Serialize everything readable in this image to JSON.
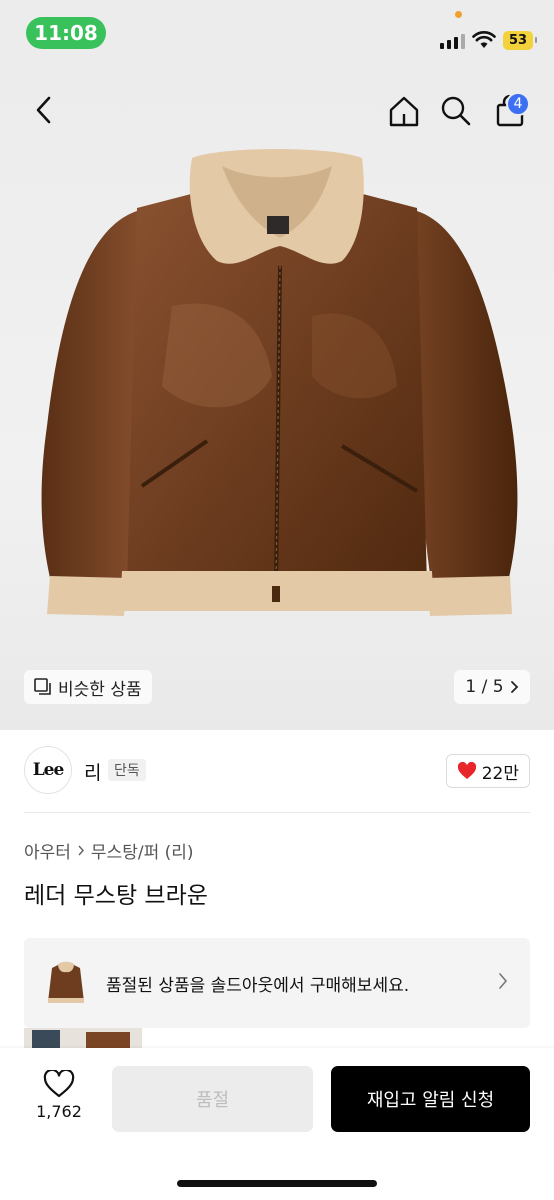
{
  "status_bar": {
    "time": "11:08",
    "battery": "53",
    "time_color": "#39c25c"
  },
  "header": {
    "cart_count": "4",
    "badge_color": "#3d6ff3"
  },
  "hero": {
    "similar_label": "비슷한 상품",
    "pager": "1 / 5"
  },
  "brand": {
    "logo_text": "Lee",
    "name": "리",
    "tag": "단독",
    "likes": "22만"
  },
  "breadcrumb": {
    "category": "아우터",
    "subcategory": "무스탕/퍼 (리)"
  },
  "product": {
    "title": "레더 무스탕 브라운"
  },
  "soldout_banner": {
    "text": "품절된 상품을 솔드아웃에서 구매해보세요."
  },
  "bottom_bar": {
    "wish_count": "1,762",
    "soldout_label": "품절",
    "restock_label": "재입고 알림 신청"
  },
  "icons": {
    "back": "chevron-left-icon",
    "home": "home-icon",
    "search": "search-icon",
    "cart": "shopping-bag-icon",
    "similar": "copy-squares-icon",
    "pager_next": "chevron-right-icon",
    "like": "heart-filled-icon",
    "breadcrumb_sep": "chevron-right-icon",
    "banner_next": "chevron-right-icon",
    "wish": "heart-outline-icon"
  }
}
